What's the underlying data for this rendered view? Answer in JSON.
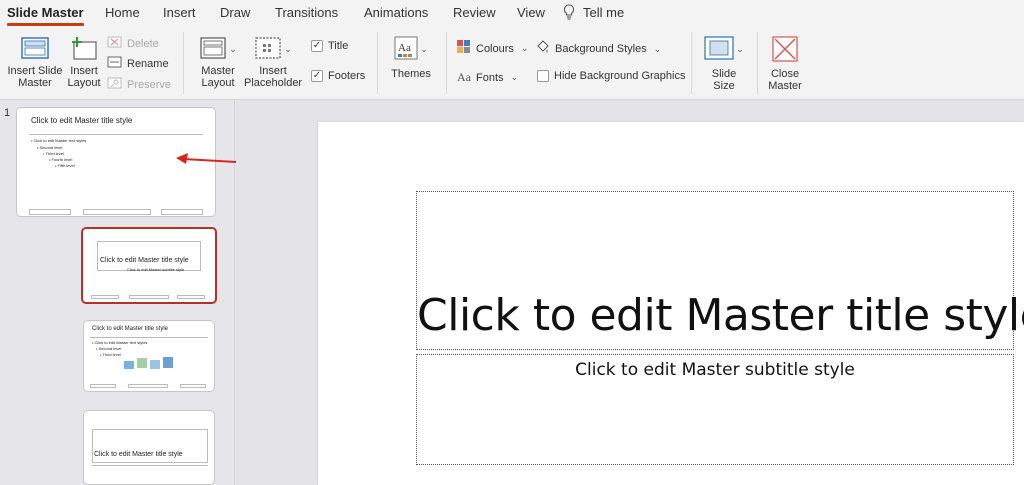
{
  "tabs": [
    {
      "label": "Slide Master",
      "active": true
    },
    {
      "label": "Home"
    },
    {
      "label": "Insert"
    },
    {
      "label": "Draw"
    },
    {
      "label": "Transitions"
    },
    {
      "label": "Animations"
    },
    {
      "label": "Review"
    },
    {
      "label": "View"
    },
    {
      "label": "Tell me"
    }
  ],
  "ribbon": {
    "insert_slide_master": {
      "line1": "Insert Slide",
      "line2": "Master"
    },
    "insert_layout": {
      "line1": "Insert",
      "line2": "Layout"
    },
    "delete": "Delete",
    "rename": "Rename",
    "preserve": "Preserve",
    "master_layout": {
      "line1": "Master",
      "line2": "Layout"
    },
    "insert_placeholder": {
      "line1": "Insert",
      "line2": "Placeholder"
    },
    "title_check": "Title",
    "footers_check": "Footers",
    "themes": "Themes",
    "colours": "Colours",
    "fonts": "Fonts",
    "background_styles": "Background Styles",
    "hide_background_graphics": "Hide Background Graphics",
    "slide_size": {
      "line1": "Slide",
      "line2": "Size"
    },
    "close_master": {
      "line1": "Close",
      "line2": "Master"
    }
  },
  "thumbnails": {
    "number": "1",
    "master": {
      "title": "Click to edit Master title style",
      "bullets": [
        "• Click to edit Master text styles",
        "• Second level",
        "• Third level",
        "• Fourth level",
        "• Fifth level"
      ]
    },
    "title_layout": {
      "title": "Click to edit Master title style",
      "subtitle": "Click to edit Master subtitle style"
    },
    "content_layout": {
      "title": "Click to edit Master title style",
      "bullets": [
        "• Click to edit Master text styles",
        "• Second level",
        "• Third level"
      ]
    },
    "section_layout": {
      "title": "Click to edit Master title style"
    }
  },
  "slide": {
    "title": "Click to edit Master title style",
    "subtitle": "Click to edit Master subtitle style"
  },
  "colors": {
    "accent": "#c43e1c",
    "selection_border": "#b3322b",
    "arrow": "#d9261c"
  }
}
